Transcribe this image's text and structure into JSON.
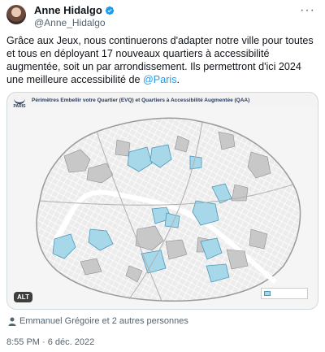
{
  "author": {
    "name": "Anne Hidalgo",
    "handle": "@Anne_Hidalgo",
    "verified_color": "#1d9bf0"
  },
  "header": {
    "more_icon": "more-horizontal-icon"
  },
  "tweet": {
    "text_before": "Grâce aux Jeux, nous continuerons d'adapter notre ville pour toutes et tous en déployant 17 nouveaux quartiers à accessibilité augmentée, soit un par arrondissement. Ils permettront d'ici 2024 une meilleure accessibilité de ",
    "mention": "@Paris",
    "text_after": "."
  },
  "media": {
    "map_title": "Périmètres Embellir votre Quartier (EVQ) et Quartiers à Accessibilité Augmentée (QAA)",
    "logo_text": "PARIS",
    "alt_label": "ALT",
    "colors": {
      "qaa_fill": "#a7d8ea",
      "qaa_stroke": "#4a98b8",
      "evq_fill": "#c8c8c8",
      "water": "#ffffff"
    }
  },
  "tagged": {
    "icon": "person-icon",
    "text": "Emmanuel Grégoire et 2 autres personnes"
  },
  "timestamp": "8:55 PM · 6 déc. 2022"
}
